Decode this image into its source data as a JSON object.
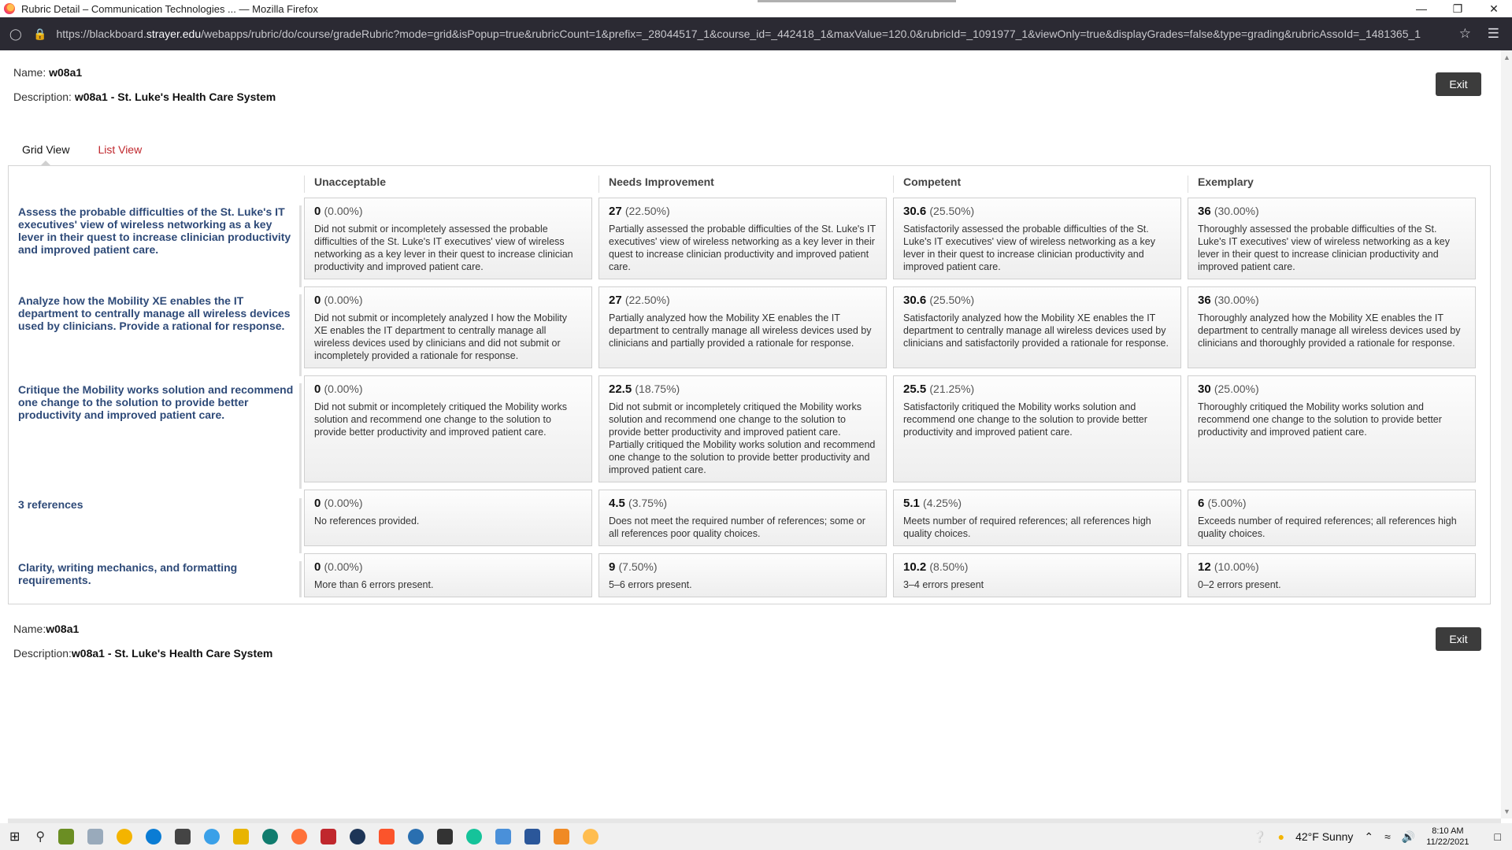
{
  "window": {
    "title": "Rubric Detail – Communication Technologies ... — Mozilla Firefox",
    "url_prefix": "https://blackboard.",
    "url_domain": "strayer.edu",
    "url_path": "/webapps/rubric/do/course/gradeRubric?mode=grid&isPopup=true&rubricCount=1&prefix=_28044517_1&course_id=_442418_1&maxValue=120.0&rubricId=_1091977_1&viewOnly=true&displayGrades=false&type=grading&rubricAssoId=_1481365_1"
  },
  "header": {
    "name_label": "Name:",
    "name_value": "w08a1",
    "description_label": "Description:",
    "description_value": "w08a1 - St. Luke's Health Care System",
    "exit_label": "Exit"
  },
  "tabs": [
    {
      "label": "Grid View"
    },
    {
      "label": "List View"
    }
  ],
  "levels": [
    "Unacceptable",
    "Needs Improvement",
    "Competent",
    "Exemplary"
  ],
  "criteria": [
    {
      "label": "Assess the probable difficulties of the St. Luke's IT executives' view of wireless networking as a key lever in their quest to increase clinician productivity and improved patient care.",
      "cells": [
        {
          "points": "0",
          "percent": "(0.00%)",
          "desc": "Did not submit or incompletely assessed the probable difficulties of the St. Luke's IT executives' view of wireless networking as a key lever in their quest to increase clinician productivity and improved patient care."
        },
        {
          "points": "27",
          "percent": "(22.50%)",
          "desc": "Partially assessed the probable difficulties of the St. Luke's IT executives' view of wireless networking as a key lever in their quest to increase clinician productivity and improved patient care."
        },
        {
          "points": "30.6",
          "percent": "(25.50%)",
          "desc": "Satisfactorily assessed the probable difficulties of the St. Luke's IT executives' view of wireless networking as a key lever in their quest to increase clinician productivity and improved patient care."
        },
        {
          "points": "36",
          "percent": "(30.00%)",
          "desc": "Thoroughly assessed the probable difficulties of the St. Luke's IT executives' view of wireless networking as a key lever in their quest to increase clinician productivity and improved patient care."
        }
      ]
    },
    {
      "label": "Analyze how the Mobility XE enables the IT department to centrally manage all wireless devices used by clinicians. Provide a rational for response.",
      "cells": [
        {
          "points": "0",
          "percent": "(0.00%)",
          "desc": "Did not submit or incompletely analyzed I how the Mobility XE enables the IT department to centrally manage all wireless devices used by clinicians and did not submit or incompletely provided a rationale for response."
        },
        {
          "points": "27",
          "percent": "(22.50%)",
          "desc": "Partially analyzed how the Mobility XE enables the IT department to centrally manage all wireless devices used by clinicians and partially provided a rationale for response."
        },
        {
          "points": "30.6",
          "percent": "(25.50%)",
          "desc": "Satisfactorily analyzed how the Mobility XE enables the IT department to centrally manage all wireless devices used by clinicians and satisfactorily provided a rationale for response."
        },
        {
          "points": "36",
          "percent": "(30.00%)",
          "desc": "Thoroughly analyzed how the Mobility XE enables the IT department to centrally manage all wireless devices used by clinicians and thoroughly provided a rationale for response."
        }
      ]
    },
    {
      "label": "Critique the Mobility works solution and recommend one change to the solution to provide better productivity and improved patient care.",
      "cells": [
        {
          "points": "0",
          "percent": "(0.00%)",
          "desc": "Did not submit or incompletely critiqued the Mobility works solution and recommend one change to the solution to provide better productivity and improved patient care."
        },
        {
          "points": "22.5",
          "percent": "(18.75%)",
          "desc": "Did not submit or incompletely critiqued the Mobility works solution and recommend one change to the solution to provide better productivity and improved patient care. Partially critiqued the Mobility works solution and recommend one change to the solution to provide better productivity and improved patient care."
        },
        {
          "points": "25.5",
          "percent": "(21.25%)",
          "desc": "Satisfactorily critiqued the Mobility works solution and recommend one change to the solution to provide better productivity and improved patient care."
        },
        {
          "points": "30",
          "percent": "(25.00%)",
          "desc": "Thoroughly critiqued the Mobility works solution and recommend one change to the solution to provide better productivity and improved patient care."
        }
      ]
    },
    {
      "label": "3 references",
      "cells": [
        {
          "points": "0",
          "percent": "(0.00%)",
          "desc": "No references provided."
        },
        {
          "points": "4.5",
          "percent": "(3.75%)",
          "desc": "Does not meet the required number of references; some or all references poor quality choices."
        },
        {
          "points": "5.1",
          "percent": "(4.25%)",
          "desc": "Meets number of required references; all references high quality choices."
        },
        {
          "points": "6",
          "percent": "(5.00%)",
          "desc": "Exceeds number of required references; all references high quality choices."
        }
      ]
    },
    {
      "label": "Clarity, writing mechanics, and formatting requirements.",
      "cells": [
        {
          "points": "0",
          "percent": "(0.00%)",
          "desc": "More than 6 errors present."
        },
        {
          "points": "9",
          "percent": "(7.50%)",
          "desc": "5–6 errors present."
        },
        {
          "points": "10.2",
          "percent": "(8.50%)",
          "desc": "3–4 errors present"
        },
        {
          "points": "12",
          "percent": "(10.00%)",
          "desc": "0–2 errors present."
        }
      ]
    }
  ],
  "taskbar": {
    "weather": "42°F  Sunny",
    "time": "8:10 AM",
    "date": "11/22/2021"
  },
  "colors": {
    "criteria_text": "#2e4a78",
    "tab_link": "#c0272d",
    "exit_button": "#3c3c3c",
    "url_bar_bg": "#2b2a33"
  }
}
